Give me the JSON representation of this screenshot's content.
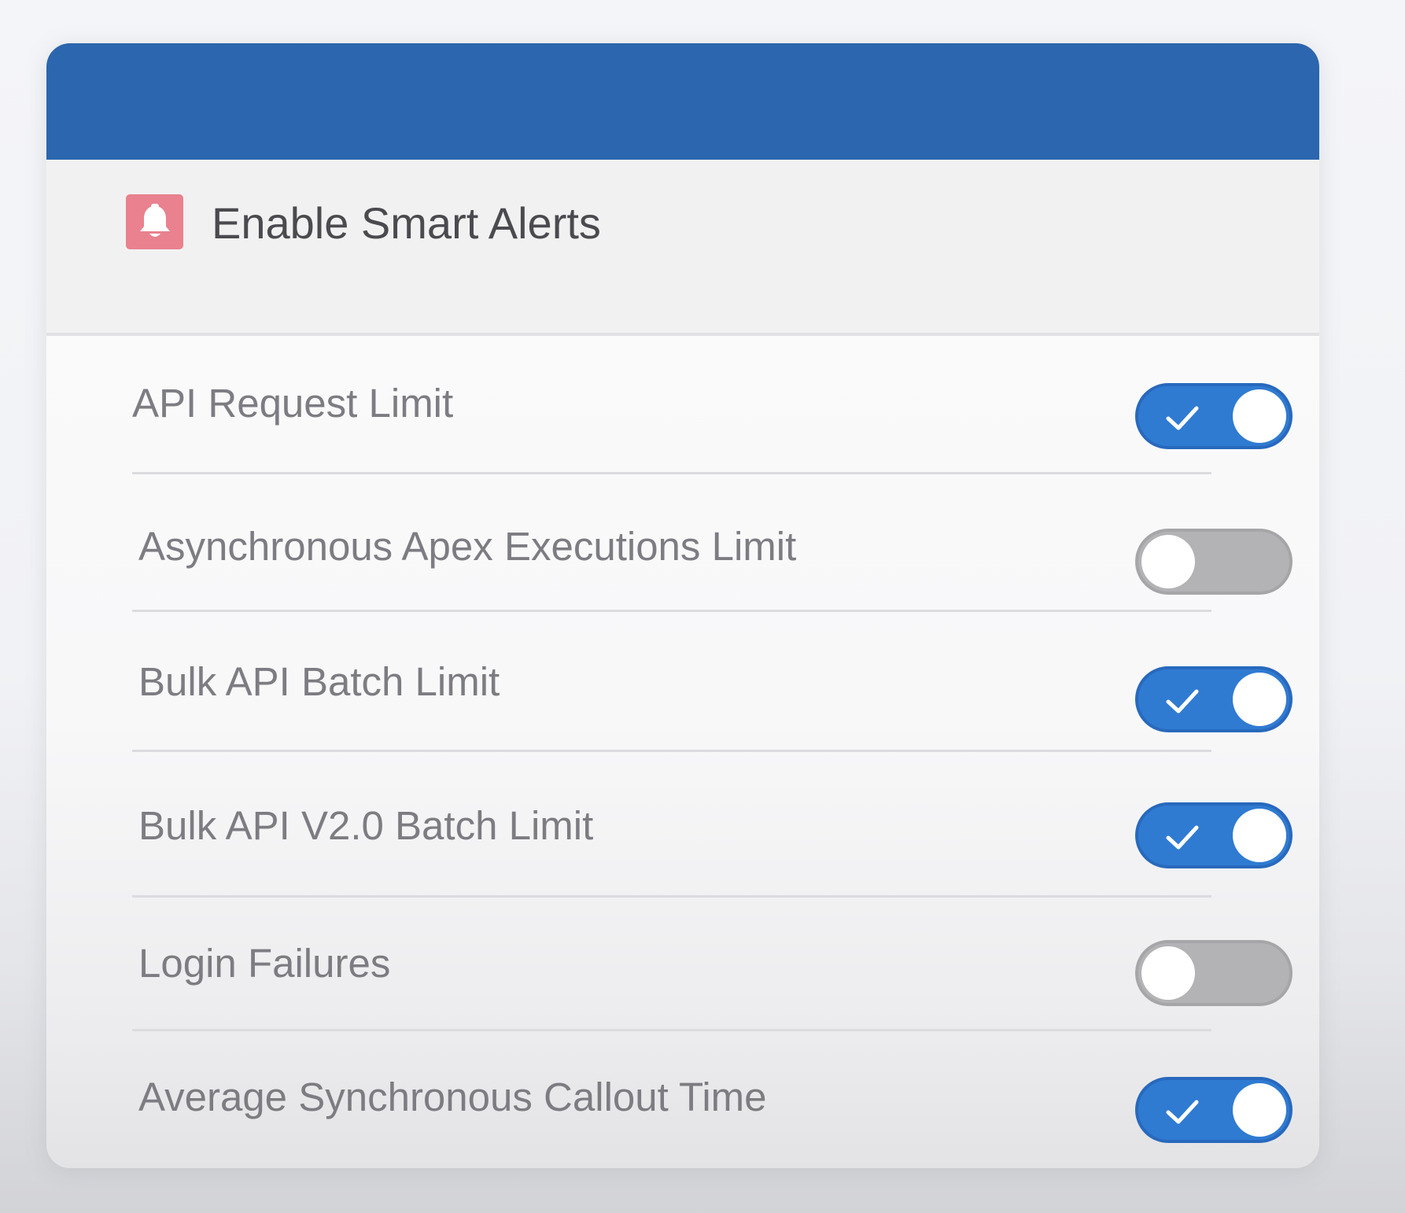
{
  "panel": {
    "title": "Enable Smart Alerts",
    "title_icon": "bell-icon",
    "header_color": "#2b66ae",
    "icon_badge_color": "#e9818e"
  },
  "alerts": [
    {
      "label": "API Request Limit",
      "enabled": true
    },
    {
      "label": "Asynchronous Apex Executions Limit",
      "enabled": false
    },
    {
      "label": "Bulk API Batch Limit",
      "enabled": true
    },
    {
      "label": "Bulk API V2.0 Batch Limit",
      "enabled": true
    },
    {
      "label": "Login Failures",
      "enabled": false
    },
    {
      "label": "Average Synchronous Callout Time",
      "enabled": true
    }
  ],
  "colors": {
    "toggle_on": "#2f7bd2",
    "toggle_off": "#b3b3b5"
  }
}
